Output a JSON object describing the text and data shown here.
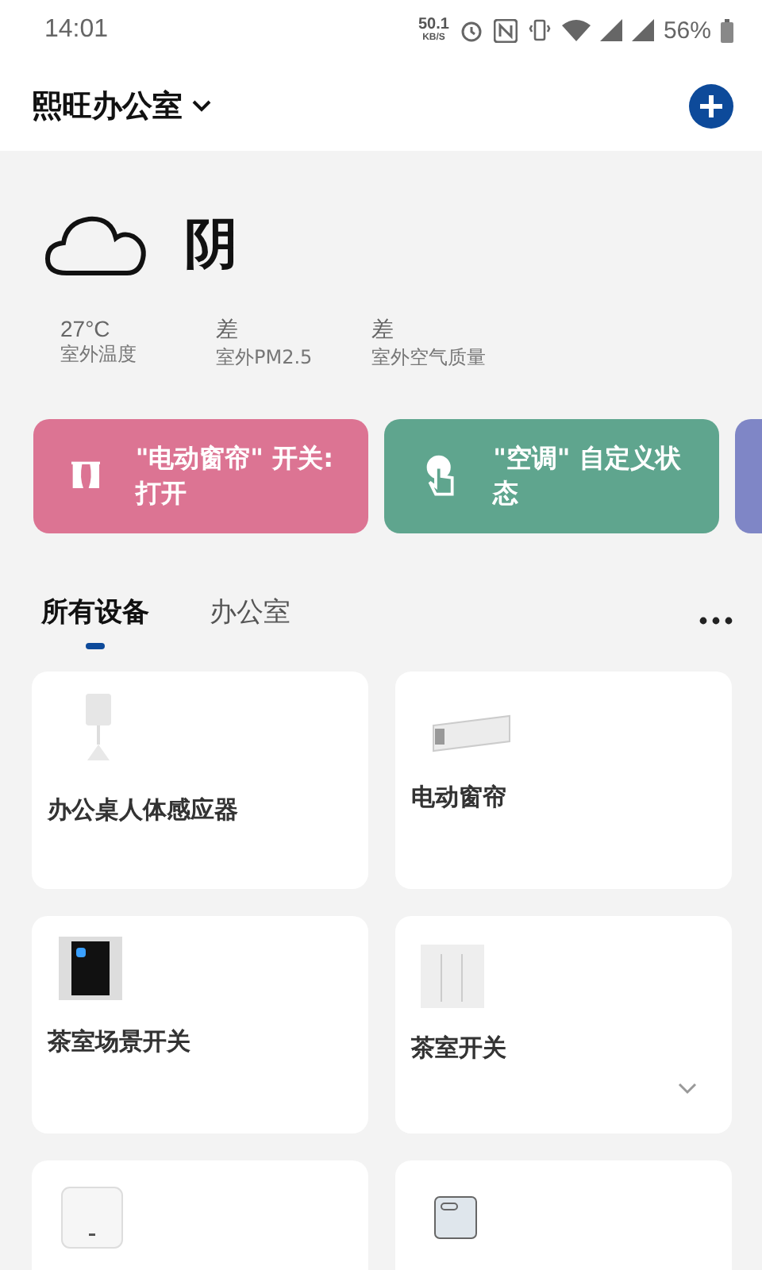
{
  "status_bar": {
    "time": "14:01",
    "speed": "50.1",
    "speed_unit": "KB/S",
    "battery": "56%"
  },
  "header": {
    "home": "熙旺办公室"
  },
  "weather": {
    "condition": "阴",
    "stats": [
      {
        "value": "27°C",
        "label": "室外温度"
      },
      {
        "value": "差",
        "label": "室外PM2.5"
      },
      {
        "value": "差",
        "label": "室外空气质量"
      }
    ]
  },
  "scenes": [
    {
      "kind": "curtain",
      "label": "\"电动窗帘\" 开关:打开",
      "color": "#dc7493"
    },
    {
      "kind": "touch",
      "label": "\"空调\" 自定义状态",
      "color": "#5fa58e"
    },
    {
      "kind": "none",
      "color": "#7f86c6"
    }
  ],
  "tabs": [
    {
      "label": "所有设备",
      "selected": true
    },
    {
      "label": "办公室",
      "selected": false
    }
  ],
  "devices": [
    {
      "kind": "sensor",
      "name": "办公桌人体感应器",
      "expandable": false
    },
    {
      "kind": "curtain-motor",
      "name": "电动窗帘",
      "expandable": false
    },
    {
      "kind": "scene-panel",
      "name": "茶室场景开关",
      "expandable": false
    },
    {
      "kind": "switch",
      "name": "茶室开关",
      "expandable": true
    },
    {
      "kind": "hub"
    },
    {
      "kind": "button"
    }
  ]
}
